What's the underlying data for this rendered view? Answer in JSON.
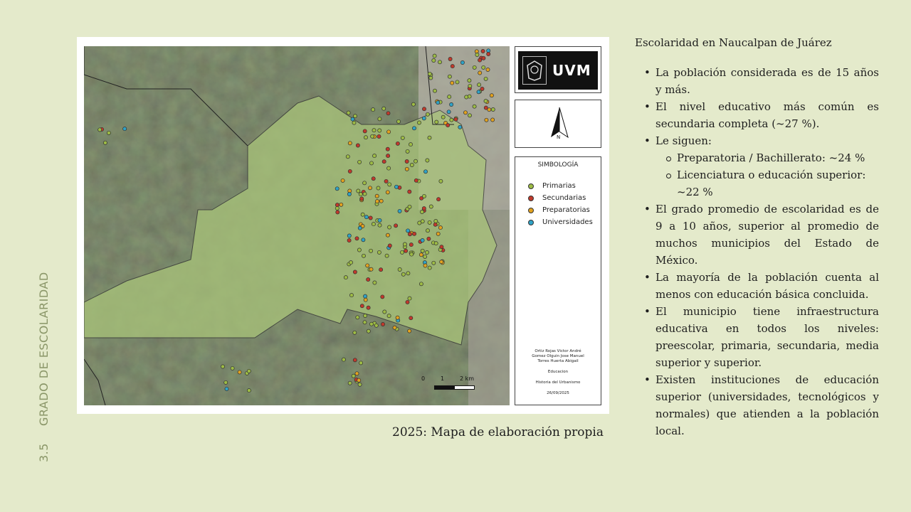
{
  "side_title": {
    "number": "3.5",
    "label": "GRADO DE ESCOLARIDAD"
  },
  "map": {
    "logo": {
      "text": "UVM"
    },
    "north_label": "N",
    "legend": {
      "title": "SIMBOLOGÍA",
      "items": [
        {
          "label": "Primarias",
          "color": "#9dbb45"
        },
        {
          "label": "Secundarias",
          "color": "#c0392b"
        },
        {
          "label": "Preparatorias",
          "color": "#e2a21f"
        },
        {
          "label": "Universidades",
          "color": "#2fa3c7"
        }
      ]
    },
    "credits": {
      "author1": "Ortiz Rojas Victor André",
      "author2": "Gomez Olguin Jose Manuel",
      "author3": "Torres Huerta Abigail",
      "subject": "Educacion",
      "course": "Historia del Urbanismo",
      "date": "26/09/2025"
    },
    "scale": {
      "l0": "0",
      "l1": "1",
      "l2": "2 km"
    }
  },
  "caption": "2025: Mapa de elaboración propia",
  "content": {
    "heading": "Escolaridad en Naucalpan de Juárez",
    "b1": "La población considerada es de 15 años y más.",
    "b2": "El nivel educativo más común es secundaria completa (~27 %).",
    "b3": "Le siguen:",
    "b3a": "Preparatoria / Bachillerato: ~24 %",
    "b3b1": "Licenciatura o educación superior:",
    "b3b2": "~22 %",
    "b4": "El grado promedio de escolaridad es de 9 a 10 años, superior al promedio de muchos municipios del Estado de México.",
    "b5": "La mayoría de la población cuenta al menos con educación básica concluida.",
    "b6": "El municipio tiene infraestructura educativa en todos los niveles: preescolar, primaria, secundaria, media superior y superior.",
    "b7": "Existen instituciones de educación superior (universidades, tecnológicos y normales) que atienden a la población local."
  }
}
